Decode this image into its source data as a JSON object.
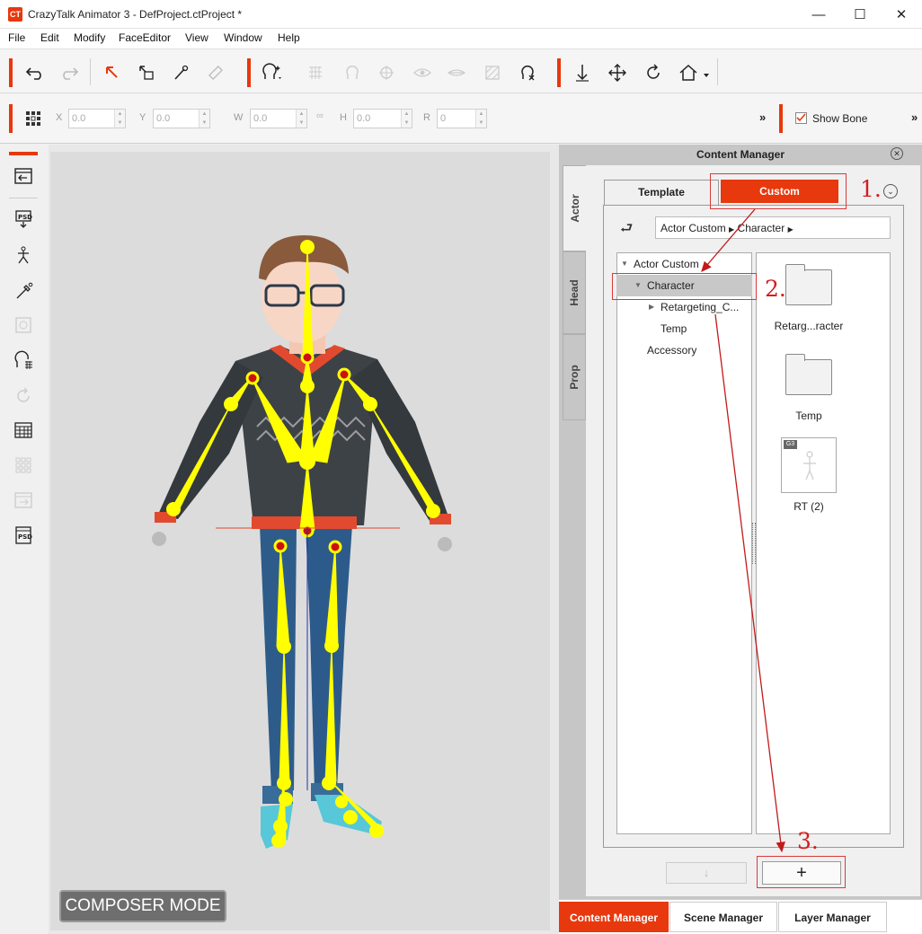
{
  "window": {
    "title": "CrazyTalk Animator 3  -  DefProject.ctProject *",
    "app_icon": "crazytalk-logo-icon"
  },
  "menu": [
    "File",
    "Edit",
    "Modify",
    "FaceEditor",
    "View",
    "Window",
    "Help"
  ],
  "transform": {
    "x_label": "X",
    "x_value": "0.0",
    "y_label": "Y",
    "y_value": "0.0",
    "w_label": "W",
    "w_value": "0.0",
    "h_label": "H",
    "h_value": "0.0",
    "r_label": "R",
    "r_value": "0",
    "more": "»",
    "show_bone_label": "Show Bone",
    "show_bone_checked": true
  },
  "viewport": {
    "mode_label": "COMPOSER MODE"
  },
  "content_manager": {
    "title": "Content Manager",
    "side_tabs": [
      "Actor",
      "Head",
      "Prop"
    ],
    "top_tabs": {
      "template": "Template",
      "custom": "Custom"
    },
    "breadcrumb": [
      "Actor Custom",
      "Character"
    ],
    "tree": [
      {
        "label": "Actor Custom",
        "level": 0,
        "expanded": true
      },
      {
        "label": "Character",
        "level": 1,
        "expanded": true,
        "selected": true
      },
      {
        "label": "Retargeting_C...",
        "level": 2,
        "expanded": false
      },
      {
        "label": "Temp",
        "level": 2
      },
      {
        "label": "Accessory",
        "level": 1
      }
    ],
    "items": [
      {
        "label": "Retarg...racter",
        "kind": "folder"
      },
      {
        "label": "Temp",
        "kind": "folder"
      },
      {
        "label": "RT (2)",
        "kind": "actor",
        "badge": "G3"
      }
    ],
    "add_label": "+",
    "download_label": "↓"
  },
  "annotations": [
    "1.",
    "2.",
    "3."
  ],
  "bottom_tabs": [
    "Content Manager",
    "Scene Manager",
    "Layer Manager"
  ],
  "colors": {
    "accent": "#e8380d",
    "annotation": "#d21e1e",
    "bone": "#ffff00"
  }
}
